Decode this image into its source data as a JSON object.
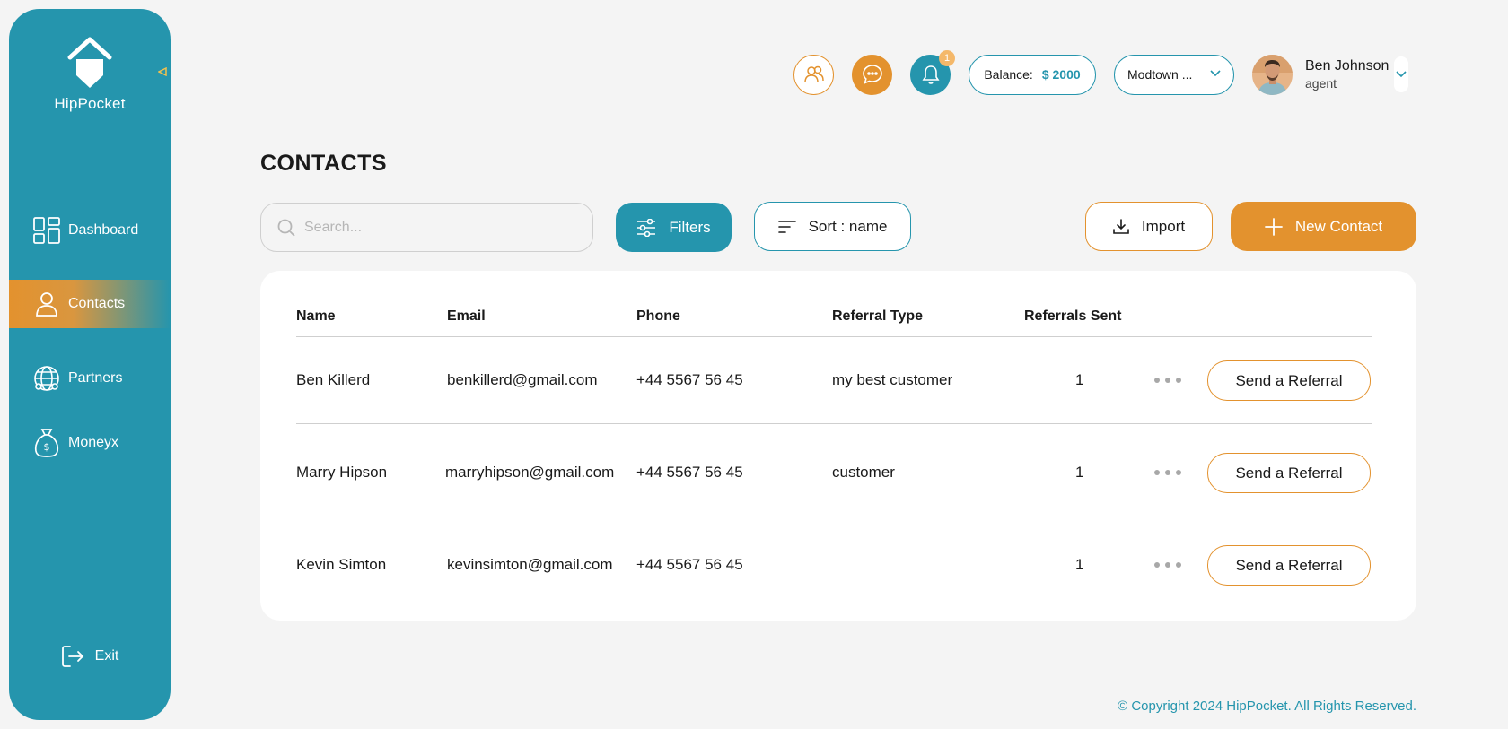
{
  "brand": {
    "name": "HipPocket"
  },
  "sidebar": {
    "items": [
      {
        "label": "Dashboard",
        "icon": "dashboard-icon"
      },
      {
        "label": "Contacts",
        "icon": "person-icon",
        "active": true
      },
      {
        "label": "Partners",
        "icon": "globe-people-icon"
      },
      {
        "label": "Moneyx",
        "icon": "money-bag-icon"
      }
    ],
    "exit_label": "Exit"
  },
  "topbar": {
    "notification_count": "1",
    "balance_label": "Balance:",
    "balance_amount": "$ 2000",
    "location": "Modtown ...",
    "user_name": "Ben Johnson",
    "user_role": "agent"
  },
  "page": {
    "title": "CONTACTS",
    "search_placeholder": "Search...",
    "filters_label": "Filters",
    "sort_label": "Sort : name",
    "import_label": "Import",
    "new_contact_label": "New Contact"
  },
  "table": {
    "headers": {
      "name": "Name",
      "email": "Email",
      "phone": "Phone",
      "referral_type": "Referral Type",
      "referrals_sent": "Referrals Sent"
    },
    "action_label": "Send a Referral",
    "rows": [
      {
        "name": "Ben Killerd",
        "email": "benkillerd@gmail.com",
        "phone": "+44 5567 56 45",
        "referral_type": "my best customer",
        "referrals_sent": "1"
      },
      {
        "name": "Marry Hipson",
        "email": "marryhipson@gmail.com",
        "phone": "+44 5567 56 45",
        "referral_type": "customer",
        "referrals_sent": "1"
      },
      {
        "name": "Kevin Simton",
        "email": "kevinsimton@gmail.com",
        "phone": "+44 5567 56 45",
        "referral_type": "",
        "referrals_sent": "1"
      }
    ]
  },
  "footer": {
    "copyright": "© Copyright 2024 HipPocket. All Rights Reserved."
  },
  "colors": {
    "teal": "#2595ad",
    "orange": "#e3922e",
    "background": "#f4f4f4"
  }
}
